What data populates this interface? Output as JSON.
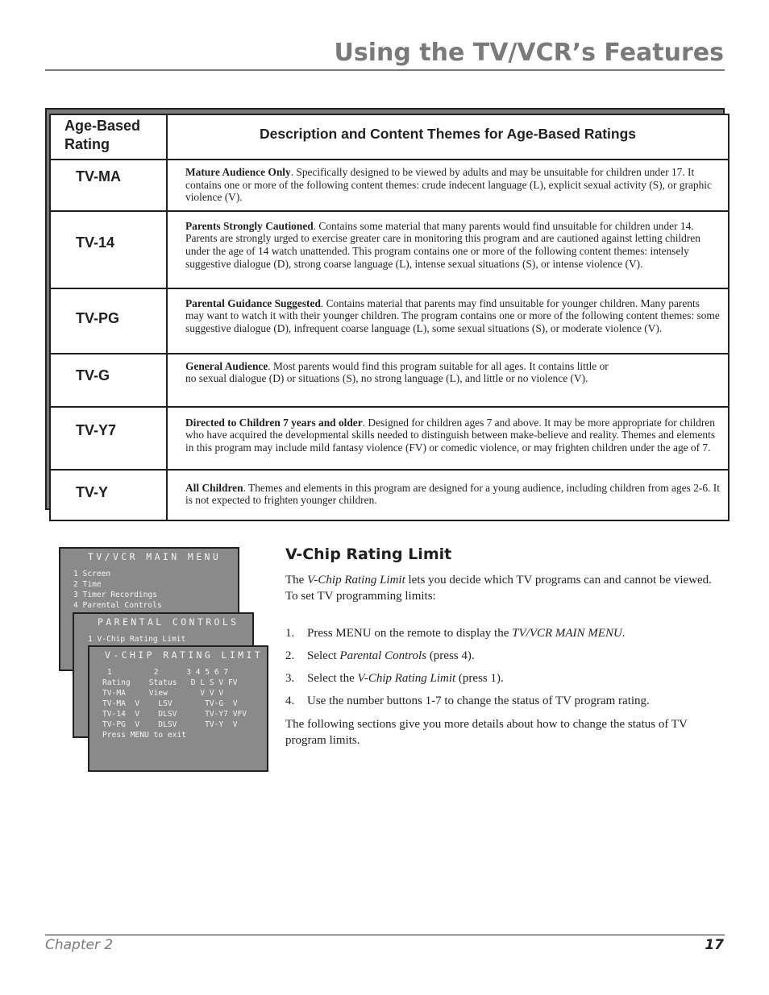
{
  "header": {
    "title": "Using the TV/VCR’s Features"
  },
  "ratings_table": {
    "headers": {
      "rating": "Age-Based Rating",
      "description": "Description and Content Themes for Age-Based Ratings"
    },
    "rows": [
      {
        "rating": "TV-MA",
        "title": "Mature Audience Only",
        "text": ". Specifically designed to be viewed by adults and may be unsuitable for children under 17.  It contains one or more of the following content themes:  crude indecent language (L), explicit sexual activity (S), or graphic violence (V)."
      },
      {
        "rating": "TV-14",
        "title": "Parents Strongly Cautioned",
        "text": ". Contains some material that many parents would find unsuitable for children under 14.  Parents are strongly urged to exercise greater care in monitoring this program and are cautioned against letting children under the age of 14 watch unattended.  This program contains one or more of the following content themes:  intensely suggestive dialogue (D), strong coarse language (L), intense sexual situations (S), or intense violence (V)."
      },
      {
        "rating": "TV-PG",
        "title": "Parental Guidance Suggested",
        "text": ". Contains material that parents may find unsuitable for younger children.  Many parents may want to watch it with their younger children.  The program contains one or more of the following content themes:  some suggestive dialogue (D), infrequent coarse language (L), some sexual situations (S), or moderate violence (V)."
      },
      {
        "rating": "TV-G",
        "title": "General Audience",
        "text": ". Most parents would find this program suitable for all ages.  It contains little or no sexual dialogue (D) or situations (S), no strong language (L), and little or no violence (V)."
      },
      {
        "rating": "TV-Y7",
        "title": "Directed to Children 7 years and older",
        "text": ". Designed for children ages 7 and above.  It may be more appropriate for children who have acquired the developmental skills needed to distinguish between make-believe and reality.  Themes and elements in this program may include mild fantasy violence (FV) or comedic violence, or may frighten children under the age of 7."
      },
      {
        "rating": "TV-Y",
        "title": "All Children",
        "text": ". Themes and elements in this program are designed for a young audience, including children from ages 2-6.  It is not expected to frighten younger children."
      }
    ]
  },
  "screens": {
    "main_menu": {
      "title": "TV/VCR MAIN MENU",
      "items": [
        "1 Screen",
        "2 Time",
        "3 Timer Recordings",
        "4 Parental Controls"
      ]
    },
    "parental_controls": {
      "title": "PARENTAL CONTROLS",
      "items": [
        "1 V-Chip Rating Limit"
      ]
    },
    "vchip": {
      "title": "V-CHIP RATING LIMIT",
      "lines": [
        "1         2      3 4 5 6 7",
        "Rating    Status   D L S V FV",
        "TV-MA     View       V V V",
        "",
        "TV-MA  V    LSV       TV-G  V",
        "TV-14  V    DLSV      TV-Y7 VFV",
        "TV-PG  V    DLSV      TV-Y  V",
        "",
        "Press MENU to exit"
      ]
    }
  },
  "section": {
    "heading": "V-Chip Rating Limit",
    "intro_pre": "The ",
    "intro_em": "V-Chip Rating Limit",
    "intro_post": " lets you decide which TV programs can and cannot be viewed.",
    "intro_line2": "To set TV programming limits:",
    "steps": [
      {
        "num": "1.",
        "pre": "Press MENU on the remote to display the ",
        "em": "TV/VCR MAIN MENU",
        "post": "."
      },
      {
        "num": "2.",
        "pre": "Select ",
        "em": "Parental Controls",
        "post": " (press 4)."
      },
      {
        "num": "3.",
        "pre": "Select the ",
        "em": "V-Chip Rating Limit",
        "post": " (press 1)."
      },
      {
        "num": "4.",
        "pre": "Use the number buttons 1-7 to change the status of TV program rating.",
        "em": "",
        "post": ""
      }
    ],
    "outro": "The following sections give you more details about how to change the status of TV program limits."
  },
  "footer": {
    "chapter": "Chapter 2",
    "page": "17"
  }
}
